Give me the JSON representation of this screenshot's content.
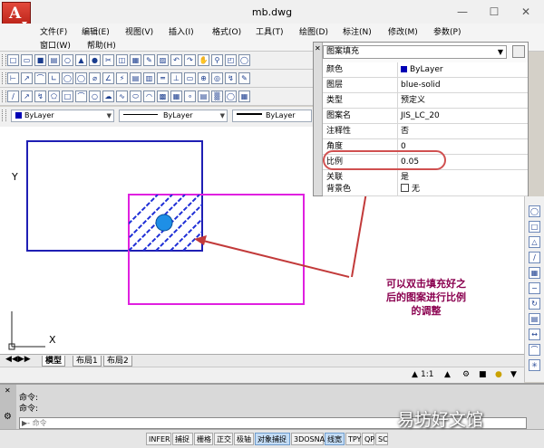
{
  "window": {
    "title": "mb.dwg",
    "controls": [
      "minimize-icon",
      "maximize-icon",
      "close-icon"
    ]
  },
  "menu": {
    "row1": [
      "文件(F)",
      "编辑(E)",
      "视图(V)",
      "插入(I)",
      "格式(O)",
      "工具(T)",
      "绘图(D)",
      "标注(N)",
      "修改(M)",
      "参数(P)"
    ],
    "row2": [
      "窗口(W)",
      "帮助(H)"
    ]
  },
  "properties_bar": {
    "color": "ByLayer",
    "linetype": "ByLayer",
    "lineweight": "ByLayer"
  },
  "palette": {
    "selected_object": "图案填充",
    "rows": [
      {
        "key": "颜色",
        "value": "ByLayer",
        "swatch": true
      },
      {
        "key": "图层",
        "value": "blue-solid"
      },
      {
        "key": "类型",
        "value": "预定义"
      },
      {
        "key": "图案名",
        "value": "JIS_LC_20"
      },
      {
        "key": "注释性",
        "value": "否"
      },
      {
        "key": "角度",
        "value": "0"
      },
      {
        "key": "比例",
        "value": "0.05"
      },
      {
        "key": "关联",
        "value": "是"
      },
      {
        "key": "背景色",
        "value": "无",
        "checkbox": true
      }
    ]
  },
  "ucs": {
    "x_label": "X",
    "y_label": "Y"
  },
  "tabs": [
    "模型",
    "布局1",
    "布局2"
  ],
  "scale_readout": "1:1",
  "command": {
    "history": [
      "命令:",
      "命令:"
    ],
    "prompt": "命令"
  },
  "status_buttons": [
    "INFER",
    "捕捉",
    "栅格",
    "正交",
    "极轴",
    "对象捕捉",
    "3DOSNAP",
    "线宽",
    "TPY",
    "QP",
    "SC"
  ],
  "status_on": [
    "对象捕捉",
    "线宽"
  ],
  "annotation": {
    "lines": [
      "可以双击填充好之",
      "后的图案进行比例",
      "的调整"
    ]
  },
  "watermark": "易坊好文馆",
  "colors": {
    "blue_rect": "#1f1fb4",
    "magenta_rect": "#e020e0",
    "hatch": "#1f2fd6",
    "circle": "#1e8fe6",
    "highlight": "#d05050",
    "arrow": "#c23a3a",
    "callout_text": "#8a004f"
  }
}
